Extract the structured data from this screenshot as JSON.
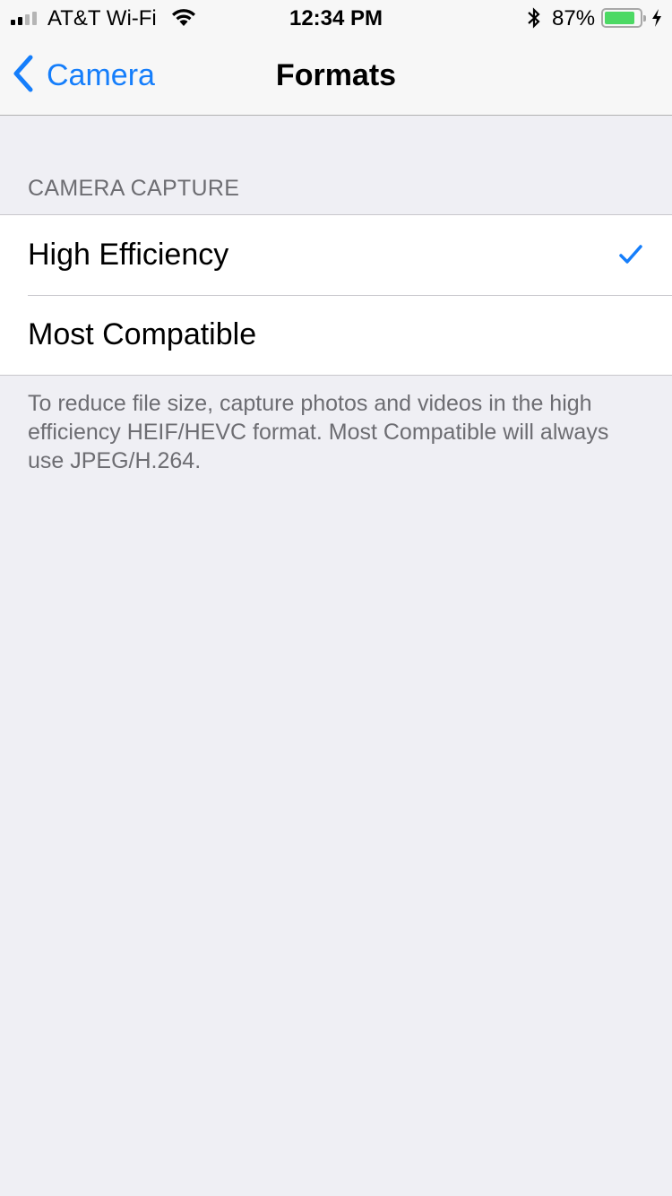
{
  "status_bar": {
    "signal_bars_filled": 2,
    "signal_bars_total": 4,
    "carrier": "AT&T Wi-Fi",
    "time": "12:34 PM",
    "battery_percent": "87%",
    "battery_level": 0.87,
    "charging": true
  },
  "nav": {
    "back_label": "Camera",
    "title": "Formats"
  },
  "section": {
    "header": "CAMERA CAPTURE",
    "options": [
      {
        "label": "High Efficiency",
        "selected": true
      },
      {
        "label": "Most Compatible",
        "selected": false
      }
    ],
    "footer": "To reduce file size, capture photos and videos in the high efficiency HEIF/HEVC format. Most Compatible will always use JPEG/H.264."
  },
  "colors": {
    "accent": "#157efb",
    "battery_fill": "#4cd964",
    "background": "#efeff4"
  }
}
